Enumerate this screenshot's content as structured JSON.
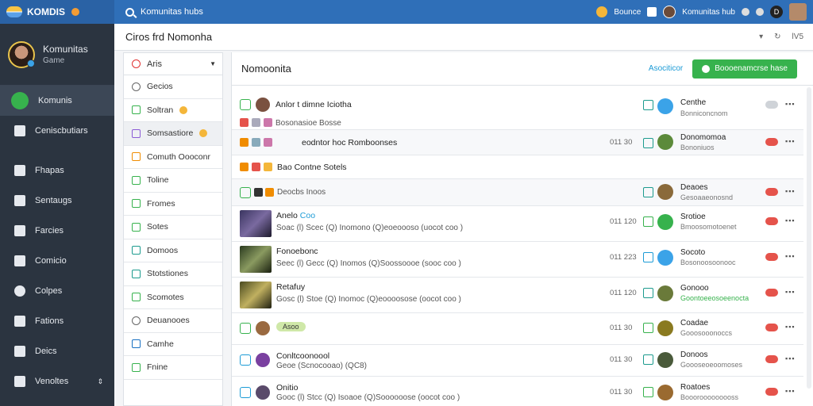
{
  "topbar": {
    "brand": "KOMDIS",
    "search_text": "Komunitas hubs",
    "right_label_1": "Bounce",
    "user_label": "Komunitas hub",
    "badge_label": "D"
  },
  "sidebar": {
    "profile_name": "Komunitas",
    "profile_sub": "Game",
    "items": [
      {
        "label": "Komunis",
        "icon": "chat-bubble-icon"
      },
      {
        "label": "Ceniscbutiars",
        "icon": "grid-icon"
      },
      {
        "label": "Fhapas",
        "icon": "bar-chart-icon"
      },
      {
        "label": "Sentaugs",
        "icon": "gear-icon"
      },
      {
        "label": "Farcies",
        "icon": "folder-icon"
      },
      {
        "label": "Comicio",
        "icon": "monitor-icon"
      },
      {
        "label": "Colpes",
        "icon": "user-icon"
      },
      {
        "label": "Fations",
        "icon": "briefcase-icon"
      },
      {
        "label": "Deics",
        "icon": "building-icon"
      },
      {
        "label": "Venoltes",
        "icon": "image-icon"
      }
    ]
  },
  "header": {
    "title": "Ciros frd Nomonha",
    "tool_label": "lV5"
  },
  "panel": {
    "select_label": "Aris",
    "items": [
      {
        "label": "Gecios"
      },
      {
        "label": "Soltran"
      },
      {
        "label": "Somsastiore"
      },
      {
        "label": "Comuth Oooconr"
      },
      {
        "label": "Toline"
      },
      {
        "label": "Fromes"
      },
      {
        "label": "Sotes"
      },
      {
        "label": "Domoos"
      },
      {
        "label": "Stotstiones"
      },
      {
        "label": "Scomotes"
      },
      {
        "label": "Deuanooes"
      },
      {
        "label": "Camhe"
      },
      {
        "label": "Fnine"
      }
    ]
  },
  "main": {
    "title": "Nomoonita",
    "link": "Asociticor",
    "button": "Boooenamcrse hase",
    "rows": [
      {
        "title": "Anlor t dimne Iciotha",
        "sub": "Bosonasioe Bosse",
        "time": "",
        "user": "Centhe",
        "user_sub": "Bonniconcnom"
      },
      {
        "title": "eodntor hoc Romboonses",
        "sub": "",
        "time": "011 30",
        "user": "Donomomoa",
        "user_sub": "Bononiuos"
      },
      {
        "title": "Bao Contne Sotels",
        "sub": "",
        "time": "",
        "user": "",
        "user_sub": ""
      },
      {
        "title": "",
        "sub": "Deocbs Inoos",
        "time": "",
        "user": "Deaoes",
        "user_sub": "Gesoaaeonosnd"
      },
      {
        "title": "Anelo",
        "sub": "Soac (l) Scec (Q) Inomono (Q)eoeoooso (uocot coo )",
        "time": "011 120",
        "user": "Srotioe",
        "user_sub": "Bmoosomotoenet"
      },
      {
        "title": "Fonoebonc",
        "sub": "Seec (l) Gecc (Q) Inomos (Q)Soossoooe (sooc coo )",
        "time": "011 223",
        "user": "Socoto",
        "user_sub": "Bosonoosoonooc"
      },
      {
        "title": "Retafuy",
        "sub": "Gosc (l) Stoe (Q) Inomoc (Q)eoooosose (oocot coo )",
        "time": "011 120",
        "user": "Gonooo",
        "user_sub": "Goontoeeosoeenocta"
      },
      {
        "title": "",
        "sub": "",
        "time": "011 30",
        "user": "Coadae",
        "user_sub": "Gooosooonoccs"
      },
      {
        "title": "Conltcoonoool",
        "sub": "Geoe (Scnocooao) (QC8)",
        "time": "011 30",
        "user": "Donoos",
        "user_sub": "Goooseoeoomoses"
      },
      {
        "title": "Onitio",
        "sub": "Gooc (l) Stcc (Q) Isoaoe (Q)Soooooose (oocot coo )",
        "time": "011 30",
        "user": "Roatoes",
        "user_sub": "Booorooooooooss"
      }
    ],
    "badge": "Asoo",
    "tag_1": "Coo"
  }
}
